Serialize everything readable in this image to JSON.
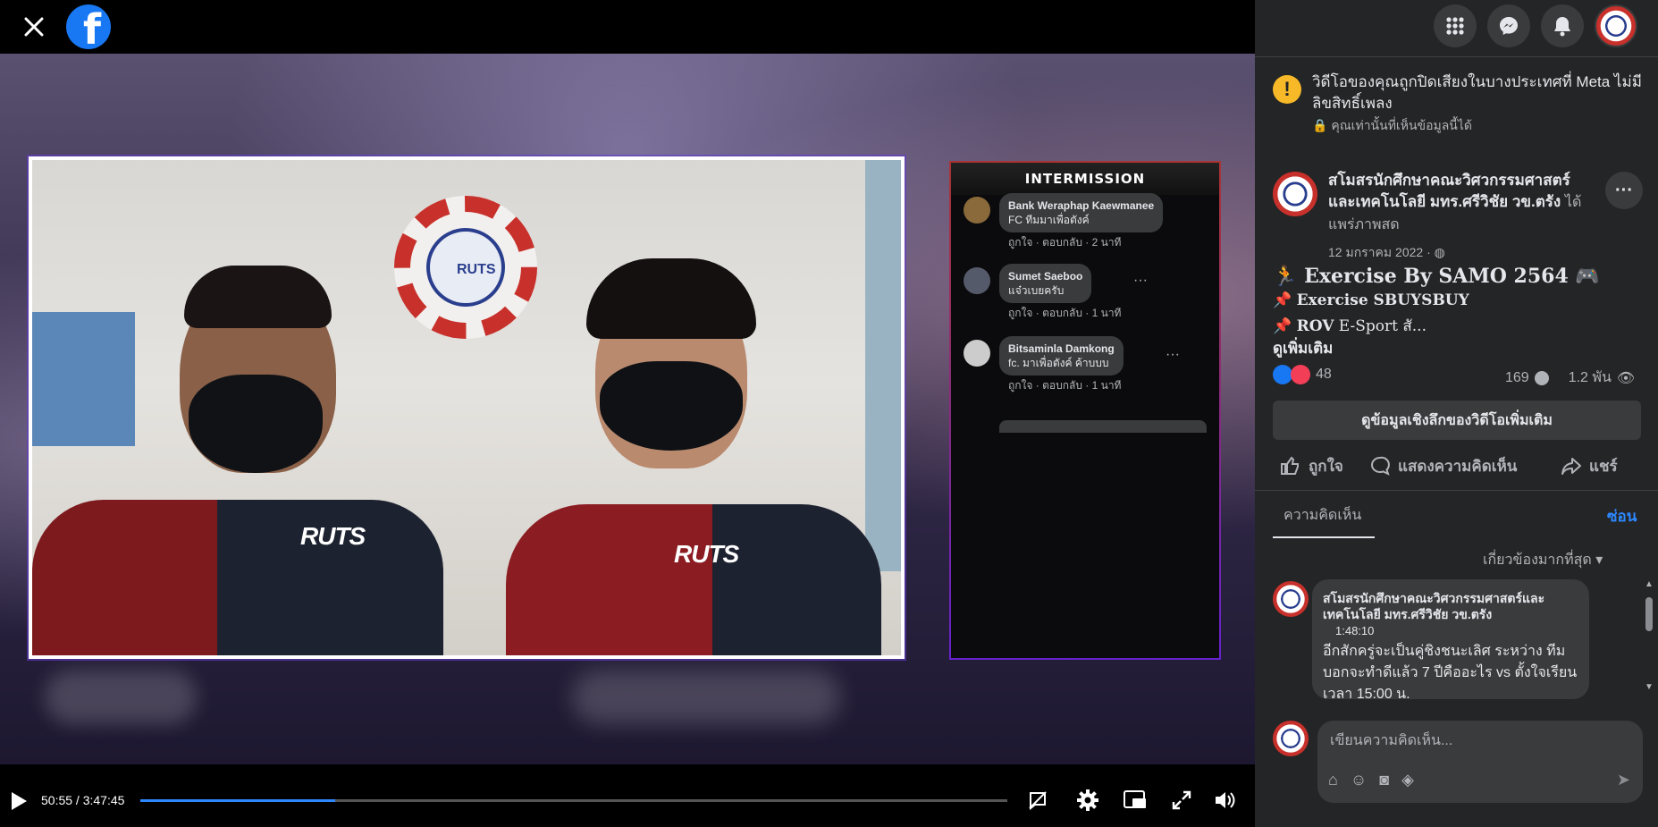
{
  "video": {
    "time_current": "50:55",
    "time_total": "3:47:45",
    "progress": 0.225,
    "overlay_title": "INTERMISSION",
    "shirt_logo": "RUTS",
    "wall_logo_text": "RUTS",
    "chat": [
      {
        "name": "Bank Weraphap Kaewmanee",
        "message": "FC ทีมมาเพื่อตังค์",
        "meta": "ถูกใจ · ตอบกลับ · 2 นาที"
      },
      {
        "name": "Sumet Saeboo",
        "message": "แจ๋วเบยครับ",
        "meta": "ถูกใจ · ตอบกลับ · 1 นาที"
      },
      {
        "name": "Bitsaminla Damkong",
        "message": "fc. มาเพื่อตังค์ ค้าบบบ",
        "meta": "ถูกใจ · ตอบกลับ · 1 นาที"
      }
    ]
  },
  "notice": {
    "text": "วิดีโอของคุณถูกปิดเสียงในบางประเทศที่ Meta ไม่มีลิขสิทธิ์เพลง",
    "sub": "คุณเท่านั้นที่เห็นข้อมูลนี้ได้"
  },
  "post": {
    "page_name": "สโมสรนักศึกษาคณะวิศวกรรมศาสตร์และเทคโนโลยี มทร.ศรีวิชัย วข.ตรัง",
    "action": "ได้แพร่ภาพสด",
    "date": "12 มกราคม 2022 ·",
    "title": "Exercise By SAMO 2564",
    "line1": "Exercise SBUYSBUY",
    "line2_bold": "ROV",
    "line2_rest": " E-Sport สั...",
    "see_more": "ดูเพิ่มเติม",
    "reactions": "48",
    "comments": "169",
    "views": "1.2 พัน",
    "insights_button": "ดูข้อมูลเชิงลึกของวิดีโอเพิ่มเติม",
    "like": "ถูกใจ",
    "comment": "แสดงความคิดเห็น",
    "share": "แชร์"
  },
  "comments_section": {
    "tab": "ความคิดเห็น",
    "hide": "ซ่อน",
    "sort": "เกี่ยวข้องมากที่สุด",
    "first_comment": {
      "author": "สโมสรนักศึกษาคณะวิศวกรรมศาสตร์และเทคโนโลยี มทร.ศรีวิชัย วข.ตรัง",
      "time": "1:48:10",
      "text": "อีกสักครู่จะเป็นคู่ชิงชนะเลิศ ระหว่าง ทีม บอกจะทำดีแล้ว 7 ปีคืออะไร vs ตั้งใจเรียน เวลา 15:00 น."
    },
    "write_placeholder": "เขียนความคิดเห็น..."
  },
  "colors": {
    "accent": "#2d88ff",
    "like_blue": "#1877f2",
    "love_red": "#f33e58",
    "warn": "#f7b928"
  }
}
